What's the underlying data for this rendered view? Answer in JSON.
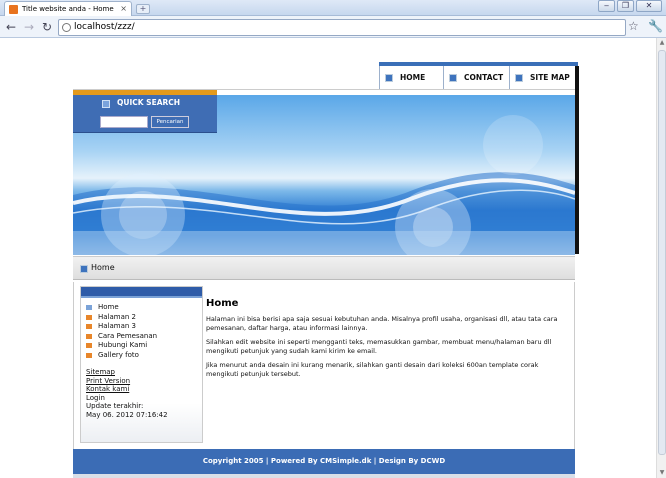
{
  "browser": {
    "tab_title": "Title website anda - Home",
    "new_tab": "+",
    "url": "localhost/zzz/",
    "window_buttons": [
      "‒",
      "❐",
      "✕"
    ]
  },
  "site": {
    "topnav": [
      "HOME",
      "CONTACT",
      "SITE MAP"
    ],
    "quick_search": {
      "label": "QUICK SEARCH",
      "input_value": "",
      "button": "Pencarian"
    },
    "breadcrumb": "Home",
    "sidebar": {
      "menu": [
        "Home",
        "Halaman 2",
        "Halaman 3",
        "Cara Pemesanan",
        "Hubungi Kami",
        "Gallery foto"
      ],
      "links": [
        "Sitemap",
        "Print Version",
        "Kontak kami"
      ],
      "login": "Login",
      "update_label": "Update terakhir:",
      "update_date": "May 06. 2012 07:16:42"
    },
    "main": {
      "title": "Home",
      "paragraphs": [
        "Halaman ini bisa berisi apa saja sesuai kebutuhan anda. Misalnya profil usaha, organisasi dll, atau tata cara pemesanan, daftar harga, atau informasi lainnya.",
        "Silahkan edit website ini seperti mengganti teks, memasukkan gambar, membuat menu/halaman baru dll mengikuti petunjuk yang sudah kami kirim ke email.",
        "Jika menurut anda desain ini kurang menarik, silahkan ganti desain dari koleksi 600an template corak mengikuti petunjuk tersebut."
      ]
    },
    "footer": "Copyright 2005 | Powered By CMSimple.dk | Design By DCWD"
  }
}
